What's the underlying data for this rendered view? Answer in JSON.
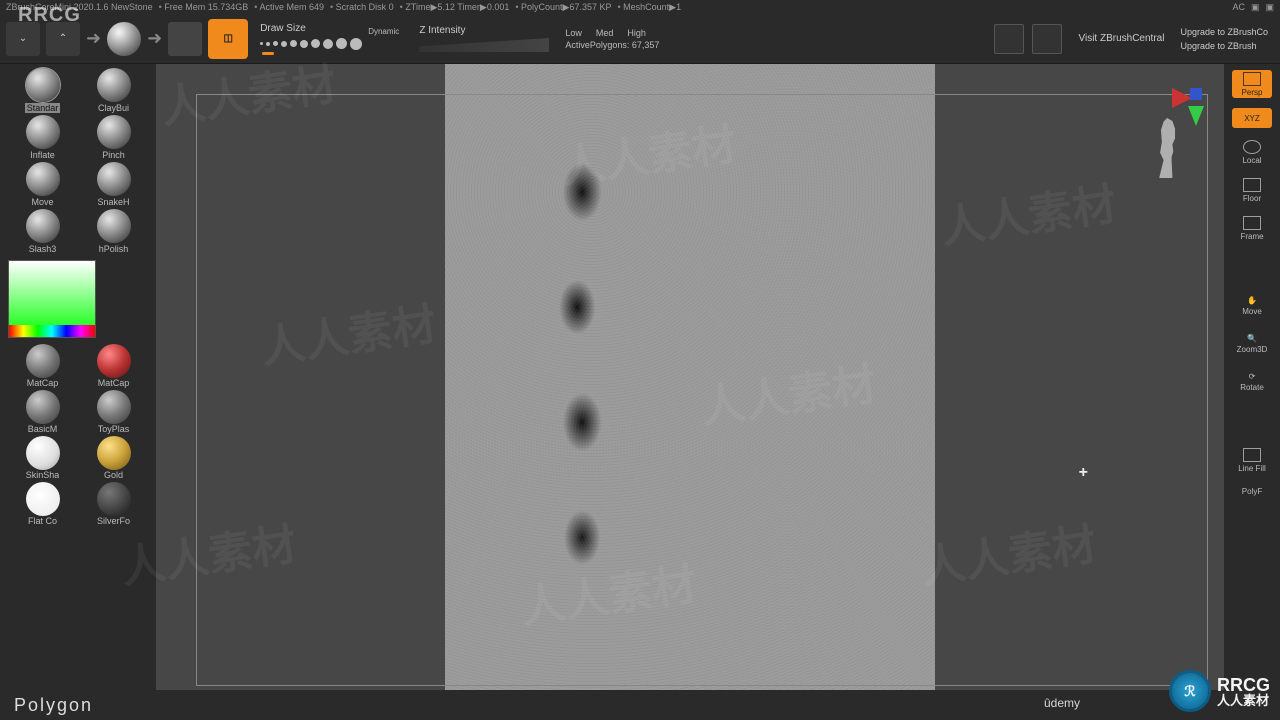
{
  "topbar": {
    "app": "ZBrushCoreMini 2020.1.6 NewStone",
    "freemem": "Free Mem 15.734GB",
    "activemem": "Active Mem 649",
    "scratch": "Scratch Disk 0",
    "ztime": "ZTime▶5.12 Timer▶0.001",
    "polycount": "PolyCount▶67.357 KP",
    "meshcount": "MeshCount▶1",
    "ac": "AC"
  },
  "toolbar": {
    "drawsize_label": "Draw Size",
    "dynamic_label": "Dynamic",
    "zintensity_label": "Z Intensity",
    "low": "Low",
    "med": "Med",
    "high": "High",
    "active_polys_label": "ActivePolygons:",
    "active_polys_value": "67,357",
    "visit": "Visit ZBrushCentral",
    "upgrade1": "Upgrade to ZBrushCo",
    "upgrade2": "Upgrade to ZBrush"
  },
  "brushes": [
    {
      "label": "Standar"
    },
    {
      "label": "ClayBui"
    },
    {
      "label": "Inflate"
    },
    {
      "label": "Pinch"
    },
    {
      "label": "Move"
    },
    {
      "label": "SnakeH"
    },
    {
      "label": "Slash3"
    },
    {
      "label": "hPolish"
    }
  ],
  "materials": [
    {
      "label": "MatCap",
      "cls": "m-gray"
    },
    {
      "label": "MatCap",
      "cls": "m-red"
    },
    {
      "label": "BasicM",
      "cls": "m-gray"
    },
    {
      "label": "ToyPlas",
      "cls": "m-gray"
    },
    {
      "label": "SkinSha",
      "cls": "m-white"
    },
    {
      "label": "Gold",
      "cls": "m-gold"
    },
    {
      "label": "Flat Co",
      "cls": "m-flat"
    },
    {
      "label": "SilverFo",
      "cls": "m-silver"
    }
  ],
  "right": {
    "persp": "Persp",
    "xyz": "XYZ",
    "local": "Local",
    "floor": "Floor",
    "frame": "Frame",
    "move": "Move",
    "zoom": "Zoom3D",
    "rotate": "Rotate",
    "linefill": "Line Fill",
    "polyf": "PolyF"
  },
  "bottom": {
    "polygon": "Polygon"
  },
  "watermark": {
    "text": "人人素材",
    "rrcg": "RRCG",
    "udemy": "ûdemy"
  }
}
